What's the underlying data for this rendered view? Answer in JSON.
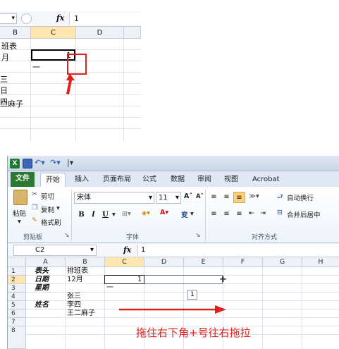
{
  "top_shot": {
    "formula_bar": {
      "fx": "fx",
      "value": "1"
    },
    "column_headers": [
      "B",
      "C",
      "D"
    ],
    "cells": [
      {
        "text": "班表"
      },
      {
        "text": "月"
      },
      {
        "text": "1"
      },
      {
        "text": "一"
      },
      {
        "text": "三"
      },
      {
        "text": "日"
      },
      {
        "text": "四"
      },
      {
        "text": "二麻子"
      }
    ],
    "colors": {
      "highlight": "#e0201a",
      "selection": "#000000"
    }
  },
  "bottom_shot": {
    "quick_access": [
      "excel-logo-icon",
      "save-icon",
      "undo-icon",
      "redo-icon",
      "customize-icon"
    ],
    "tabs": [
      "文件",
      "开始",
      "插入",
      "页面布局",
      "公式",
      "数据",
      "审阅",
      "视图",
      "Acrobat"
    ],
    "ribbon": {
      "clipboard": {
        "paste": "粘贴",
        "cut": "剪切",
        "copy": "复制",
        "format_painter": "格式刷",
        "label": "剪贴板"
      },
      "font": {
        "font_name": "宋体",
        "font_size": "11",
        "bold": "B",
        "italic": "I",
        "underline": "U",
        "phonetic": "变",
        "label": "字体"
      },
      "alignment": {
        "wrap_text": "自动换行",
        "merge_center": "合并后居中",
        "label": "对齐方式"
      }
    },
    "formula_bar": {
      "name_box": "C2",
      "fx": "fx",
      "value": "1"
    },
    "column_headers": [
      "A",
      "B",
      "C",
      "D",
      "E",
      "F",
      "G",
      "H"
    ],
    "row_headers": [
      "1",
      "2",
      "3",
      "4",
      "5",
      "6",
      "7",
      "8"
    ],
    "cells": {
      "a1": "表头",
      "b1": "排班表",
      "a2": "日期",
      "b2": "12月",
      "c2": "1",
      "a3": "星期",
      "c3": "一",
      "b4": "张三",
      "a5": "姓名",
      "b5": "李四",
      "b6": "王二麻子"
    },
    "autofill_badge": "1",
    "annotation": "拖住右下角+号往右拖拉",
    "colors": {
      "file_tab": "#2a7a31",
      "annotation": "#e0201a",
      "arrow": "#e0201a",
      "highlight_button": "#fbd27a"
    }
  }
}
